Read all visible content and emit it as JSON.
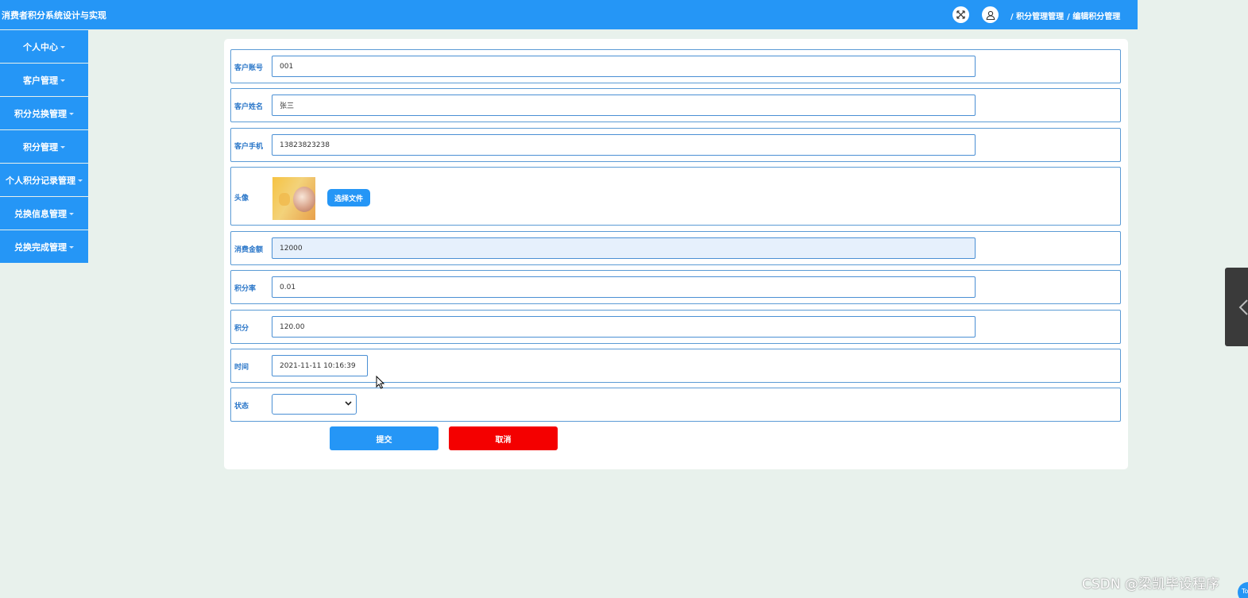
{
  "header": {
    "app_title": "消费者积分系统设计与实现",
    "breadcrumb": [
      "/ 积分管理管理",
      "/ 编辑积分管理"
    ]
  },
  "sidebar": {
    "items": [
      {
        "label": "个人中心"
      },
      {
        "label": "客户管理"
      },
      {
        "label": "积分兑换管理"
      },
      {
        "label": "积分管理"
      },
      {
        "label": "个人积分记录管理"
      },
      {
        "label": "兑换信息管理"
      },
      {
        "label": "兑换完成管理"
      }
    ]
  },
  "form": {
    "customer_account": {
      "label": "客户账号",
      "value": "001"
    },
    "customer_name": {
      "label": "客户姓名",
      "value": "张三"
    },
    "customer_phone": {
      "label": "客户手机",
      "value": "13823823238"
    },
    "avatar": {
      "label": "头像",
      "button": "选择文件"
    },
    "amount": {
      "label": "消费金额",
      "value": "12000"
    },
    "rate": {
      "label": "积分率",
      "value": "0.01"
    },
    "points": {
      "label": "积分",
      "value": "120.00"
    },
    "time": {
      "label": "时间",
      "value": "2021-11-11 10:16:39"
    },
    "status": {
      "label": "状态",
      "value": ""
    },
    "submit_label": "提交",
    "cancel_label": "取消"
  },
  "floating": {
    "top_button": "Top"
  },
  "watermark": "CSDN @梁凯毕设程序",
  "colors": {
    "primary": "#2596f6",
    "danger": "#f40000",
    "background": "#e8f1ec",
    "field_border": "#4a8fd4",
    "label": "#2b77c9"
  },
  "icons": {
    "fullscreen": "fullscreen-icon",
    "user": "user-icon",
    "select_chevron": "chevron-down-icon",
    "panel_toggle": "chevron-left-icon"
  }
}
